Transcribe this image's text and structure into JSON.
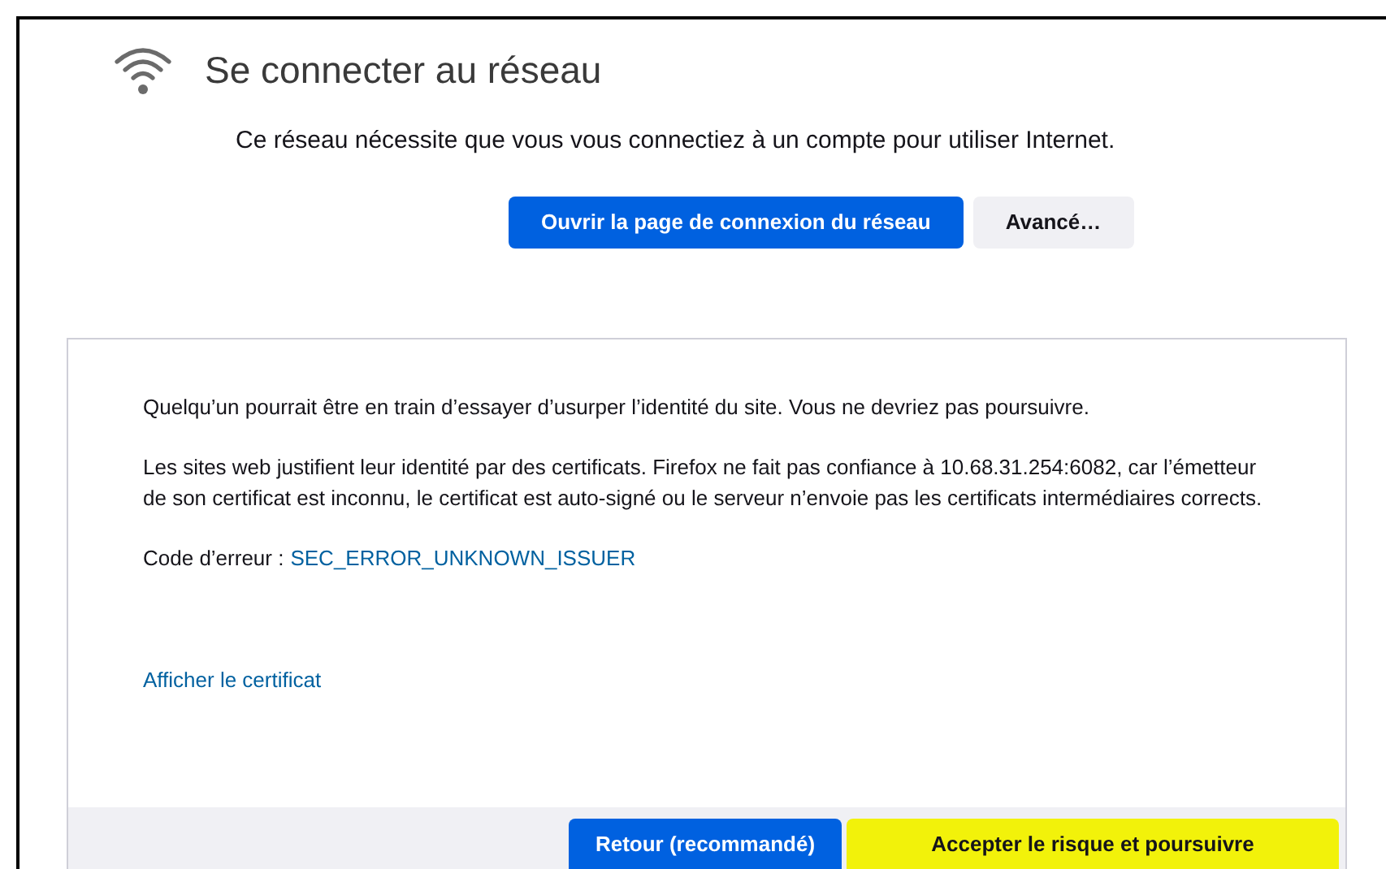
{
  "header": {
    "title": "Se connecter au réseau",
    "message": "Ce réseau nécessite que vous vous connectiez à un compte pour utiliser Internet.",
    "buttons": [
      {
        "label": "Ouvrir la page de connexion du réseau",
        "kind": "primary"
      },
      {
        "label": "Avancé…",
        "kind": "secondary"
      }
    ]
  },
  "warning": {
    "paragraphs": [
      "Quelqu’un pourrait être en train d’essayer d’usurper l’identité du site. Vous ne devriez pas poursuivre.",
      "Les sites web justifient leur identité par des certificats. Firefox ne fait pas confiance à 10.68.31.254:6082, car l’émetteur de son certificat est inconnu, le certificat est auto-signé ou le serveur n’envoie pas les certificats intermédiaires corrects."
    ],
    "error_label": "Code d’erreur :",
    "error_code": "SEC_ERROR_UNKNOWN_ISSUER",
    "link": "Afficher le certificat",
    "buttons": [
      {
        "label": "Retour (recommandé)",
        "kind": "primary"
      },
      {
        "label": "Accepter le risque et poursuivre",
        "kind": "highlighted"
      }
    ]
  }
}
